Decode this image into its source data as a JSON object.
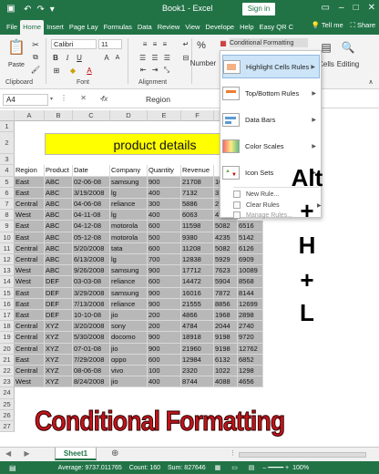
{
  "titlebar": {
    "title": "Book1 - Excel",
    "signin": "Sign in"
  },
  "menu": {
    "tabs": [
      "File",
      "Home",
      "Insert",
      "Page Lay",
      "Formulas",
      "Data",
      "Review",
      "View",
      "Develope",
      "Help",
      "Easy QR C"
    ],
    "tell_me": "Tell me",
    "share": "Share"
  },
  "ribbon": {
    "paste": "Paste",
    "clipboard": "Clipboard",
    "font_label": "Font",
    "font_name": "Calibri",
    "font_size": "11",
    "alignment": "Alignment",
    "number": "Number",
    "cells": "Cells",
    "editing": "Editing",
    "cond_format": "Conditional Formatting"
  },
  "formula_bar": {
    "name_box": "A4",
    "fx": "fx",
    "formula": "Region"
  },
  "columns": [
    "A",
    "B",
    "C",
    "D",
    "E",
    "F",
    "G"
  ],
  "rows": [
    "1",
    "2",
    "3",
    "4",
    "5",
    "6",
    "7",
    "8",
    "9",
    "10",
    "11",
    "12",
    "13",
    "14",
    "15",
    "16",
    "17",
    "18",
    "19",
    "20",
    "21",
    "22",
    "23",
    "24",
    "25",
    "26",
    "27"
  ],
  "sheet_title": "product details",
  "table": {
    "headers": [
      "Region",
      "Product",
      "Date",
      "Company",
      "Quantity",
      "Revenue",
      ""
    ],
    "data": [
      [
        "East",
        "ABC",
        "02-06-08",
        "samsung",
        "900",
        "21708",
        "10"
      ],
      [
        "East",
        "ABC",
        "3/19/2008",
        "lg",
        "400",
        "7132",
        "3"
      ],
      [
        "Central",
        "ABC",
        "04-06-08",
        "reliance",
        "300",
        "5886",
        "2"
      ],
      [
        "West",
        "ABC",
        "04-11-08",
        "lg",
        "400",
        "6063",
        "4"
      ],
      [
        "East",
        "ABC",
        "04-12-08",
        "motorola",
        "600",
        "11598",
        "5082",
        "6516"
      ],
      [
        "East",
        "ABC",
        "05-12-08",
        "motorola",
        "500",
        "9380",
        "4235",
        "5142"
      ],
      [
        "Central",
        "ABC",
        "5/20/2008",
        "tata",
        "600",
        "11208",
        "5082",
        "6126"
      ],
      [
        "Central",
        "ABC",
        "6/13/2008",
        "lg",
        "700",
        "12838",
        "5929",
        "6909"
      ],
      [
        "West",
        "ABC",
        "9/26/2008",
        "samsung",
        "900",
        "17712",
        "7623",
        "10089"
      ],
      [
        "West",
        "DEF",
        "03-03-08",
        "reliance",
        "600",
        "14472",
        "5904",
        "8568"
      ],
      [
        "East",
        "DEF",
        "3/29/2008",
        "samsung",
        "900",
        "16016",
        "7872",
        "8144"
      ],
      [
        "East",
        "DEF",
        "7/13/2008",
        "reliance",
        "900",
        "21555",
        "8856",
        "12699"
      ],
      [
        "East",
        "DEF",
        "10-10-08",
        "jio",
        "200",
        "4866",
        "1968",
        "2898"
      ],
      [
        "Central",
        "XYZ",
        "3/20/2008",
        "sony",
        "200",
        "4784",
        "2044",
        "2740"
      ],
      [
        "Central",
        "XYZ",
        "5/30/2008",
        "docomo",
        "900",
        "18918",
        "9198",
        "9720"
      ],
      [
        "Central",
        "XYZ",
        "07-01-08",
        "jio",
        "900",
        "21960",
        "9198",
        "12762"
      ],
      [
        "East",
        "XYZ",
        "7/29/2008",
        "oppo",
        "600",
        "12984",
        "6132",
        "6852"
      ],
      [
        "Central",
        "XYZ",
        "08-06-08",
        "vivo",
        "100",
        "2320",
        "1022",
        "1298"
      ],
      [
        "West",
        "XYZ",
        "8/24/2008",
        "jio",
        "400",
        "8744",
        "4088",
        "4656"
      ]
    ]
  },
  "dropdown": {
    "items": [
      "Highlight Cells Rules",
      "Top/Bottom Rules",
      "Data Bars",
      "Color Scales",
      "Icon Sets"
    ],
    "small": [
      "New Rule...",
      "Clear Rules",
      "Manage Rules..."
    ]
  },
  "hotkeys": [
    "Alt",
    "+",
    "H",
    "+",
    "L"
  ],
  "banner": "Conditional Formatting",
  "sheet_tab": "Sheet1",
  "status": {
    "average": "Average: 9737.011765",
    "count": "Count: 160",
    "sum": "Sum: 827646",
    "zoom": "100%"
  },
  "colors": {
    "excel_green": "#217346",
    "title_yellow": "#ffff00",
    "banner_red": "#c0141b",
    "selection_gray": "#b8b8b8"
  }
}
